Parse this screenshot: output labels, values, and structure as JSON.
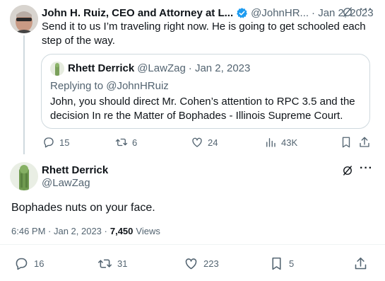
{
  "tweet1": {
    "name": "John H. Ruiz, CEO and Attorney at L...",
    "handle": "@JohnHR...",
    "date": "· Jan 2, 2023",
    "text": "Send it to us I’m traveling right now.  He is going to get schooled each step of the way.",
    "quote": {
      "name": "Rhett Derrick",
      "handle": "@LawZag",
      "date": "· Jan 2, 2023",
      "replying": "Replying to @JohnHRuiz",
      "text": "John, you should direct Mr. Cohen’s attention to RPC 3.5 and the decision In re the Matter of Bophades - Illinois Supreme Court."
    },
    "actions": {
      "replies": "15",
      "retweets": "6",
      "likes": "24",
      "views": "43K"
    }
  },
  "tweet2": {
    "name": "Rhett Derrick",
    "handle": "@LawZag",
    "text": "Bophades nuts on your face.",
    "time": "6:46 PM · Jan 2, 2023 ·",
    "views_count": "7,450",
    "views_label": "Views",
    "actions": {
      "replies": "16",
      "retweets": "31",
      "likes": "223",
      "bookmarks": "5"
    }
  },
  "icons": {
    "verified": "verified-badge-icon",
    "grok": "grok-icon",
    "more": "more-icon",
    "reply": "reply-icon",
    "retweet": "retweet-icon",
    "like": "like-icon",
    "views": "views-icon",
    "bookmark": "bookmark-icon",
    "share": "share-icon"
  },
  "colors": {
    "verified": "#1d9bf0",
    "muted": "#536471",
    "border": "#cfd9de"
  }
}
